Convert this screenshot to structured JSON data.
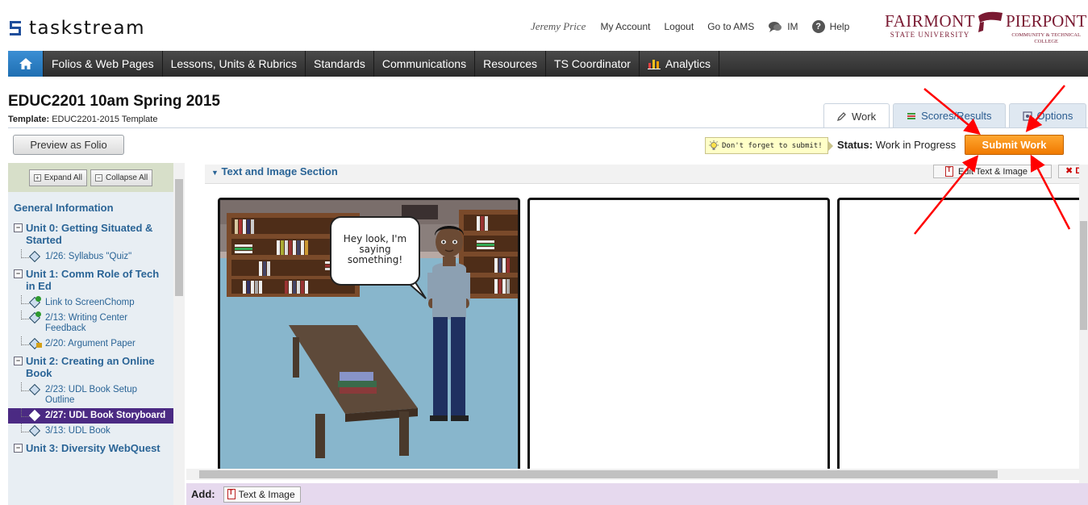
{
  "app": {
    "logo_text": "taskstream",
    "brand_left": "FAIRMONT",
    "brand_left_sub": "STATE UNIVERSITY",
    "brand_right": "PIERPONT",
    "brand_right_sub1": "COMMUNITY & TECHNICAL",
    "brand_right_sub2": "COLLEGE"
  },
  "toplinks": {
    "user": "Jeremy Price",
    "my_account": "My Account",
    "logout": "Logout",
    "go_to_ams": "Go to AMS",
    "im": "IM",
    "help": "Help"
  },
  "nav": {
    "items": [
      "Folios & Web Pages",
      "Lessons, Units & Rubrics",
      "Standards",
      "Communications",
      "Resources",
      "TS Coordinator",
      "Analytics"
    ]
  },
  "page": {
    "title": "EDUC2201 10am Spring 2015",
    "template_label": "Template:",
    "template_value": "EDUC2201-2015 Template",
    "preview_button": "Preview as Folio"
  },
  "tabs": [
    "Work",
    "Scores/Results",
    "Options"
  ],
  "status": {
    "reminder": "Don't forget to submit!",
    "label": "Status:",
    "value": "Work in Progress",
    "submit": "Submit Work"
  },
  "sidebar": {
    "expand_all": "Expand All",
    "collapse_all": "Collapse All",
    "general": "General Information",
    "sections": [
      {
        "title": "Unit 0: Getting Situated & Started",
        "items": [
          "1/26: Syllabus \"Quiz\""
        ]
      },
      {
        "title": "Unit 1: Comm Role of Tech in Ed",
        "items": [
          "Link to ScreenChomp",
          "2/13: Writing Center Feedback",
          "2/20: Argument Paper"
        ]
      },
      {
        "title": "Unit 2: Creating an Online Book",
        "items": [
          "2/23: UDL Book Setup Outline",
          "2/27: UDL Book Storyboard",
          "3/13: UDL Book"
        ]
      },
      {
        "title": "Unit 3: Diversity WebQuest",
        "items": []
      }
    ]
  },
  "main": {
    "section_title": "Text and Image Section",
    "edit_button": "Edit Text & Image",
    "delete_button": "D",
    "speech_bubble": "Hey look, I'm saying something!",
    "add_label": "Add:",
    "add_button": "Text & Image"
  },
  "colors": {
    "accent_orange": "#f08a00",
    "nav_dark": "#333333",
    "link_blue": "#2a6496",
    "selected_purple": "#4b2a83",
    "annotation_red": "#ff0000"
  }
}
